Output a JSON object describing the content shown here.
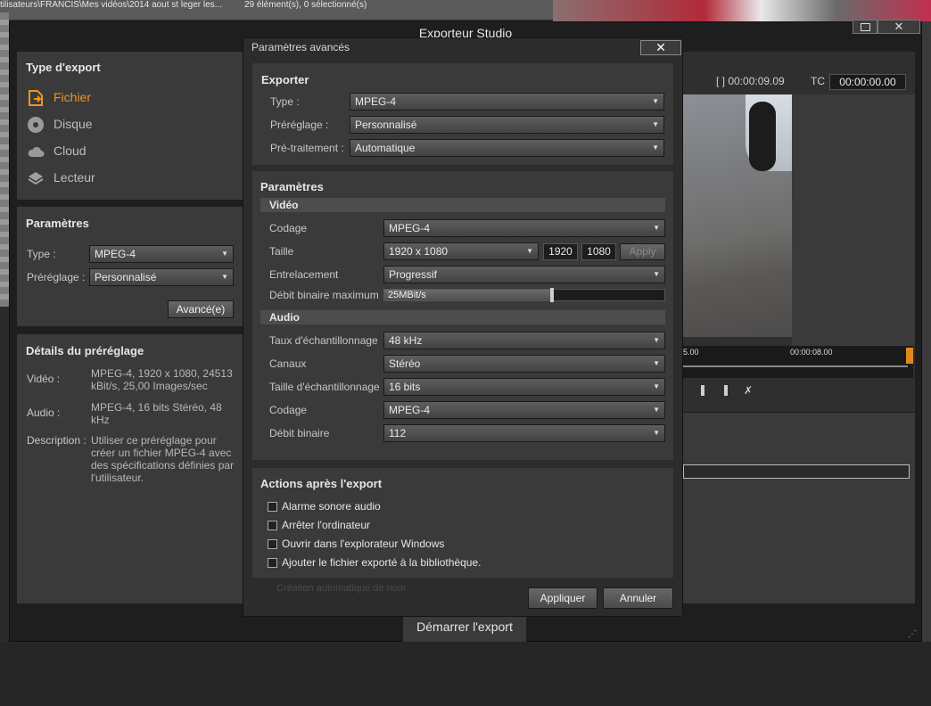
{
  "background": {
    "explorer_path": "tilisateurs\\FRANCIS\\Mes vidéos\\2014 aout st leger les...",
    "explorer_count": "29 élément(s), 0 sélectionné(s)",
    "ghost_caption": "Création automatique de nom"
  },
  "window": {
    "title": "Exporteur Studio",
    "maximize_icon": "maximize-icon",
    "close_label": "✕"
  },
  "export_type": {
    "title": "Type d'export",
    "items": [
      {
        "label": "Fichier",
        "icon": "file-export-icon",
        "active": true
      },
      {
        "label": "Disque",
        "icon": "disc-icon",
        "active": false
      },
      {
        "label": "Cloud",
        "icon": "cloud-icon",
        "active": false
      },
      {
        "label": "Lecteur",
        "icon": "device-icon",
        "active": false
      }
    ]
  },
  "params": {
    "title": "Paramètres",
    "type_label": "Type :",
    "type_value": "MPEG-4",
    "preset_label": "Préréglage :",
    "preset_value": "Personnalisé",
    "advanced_button": "Avancé(e)"
  },
  "preset_details": {
    "title": "Détails du préréglage",
    "video_label": "Vidéo :",
    "video_value": "MPEG-4, 1920 x 1080, 24513 kBit/s, 25,00 Images/sec",
    "audio_label": "Audio :",
    "audio_value": "MPEG-4, 16 bits Stéréo, 48 kHz",
    "description_label": "Description :",
    "description_value": "Utiliser ce préréglage pour créer un fichier MPEG-4 avec des spécifications définies par l'utilisateur."
  },
  "preview": {
    "duration": "[ ] 00:00:09.09",
    "tc_label": "TC",
    "tc_value": "00:00:00.00",
    "tick_left": "5.00",
    "tick_right": "00:00:08.00",
    "accent": "#e08a1c"
  },
  "start_button": "Démarrer l'export",
  "advanced": {
    "title": "Paramètres avancés",
    "close_label": "✕",
    "exporter": {
      "title": "Exporter",
      "type_label": "Type :",
      "type_value": "MPEG-4",
      "preset_label": "Préréglage :",
      "preset_value": "Personnalisé",
      "pre_label": "Pré-traitement :",
      "pre_value": "Automatique"
    },
    "settings": {
      "title": "Paramètres",
      "video_header": "Vidéo",
      "codec_label": "Codage",
      "codec_value": "MPEG-4",
      "size_label": "Taille",
      "size_value": "1920 x 1080",
      "width": "1920",
      "height": "1080",
      "apply_small": "Apply",
      "interlace_label": "Entrelacement",
      "interlace_value": "Progressif",
      "bitrate_max_label": "Débit binaire maximum",
      "bitrate_max_value": "25MBit/s",
      "bitrate_max_fraction": 0.6,
      "audio_header": "Audio",
      "samplerate_label": "Taux d'échantillonnage",
      "samplerate_value": "48 kHz",
      "channels_label": "Canaux",
      "channels_value": "Stéréo",
      "samplesize_label": "Taille d'échantillonnage",
      "samplesize_value": "16 bits",
      "acodec_label": "Codage",
      "acodec_value": "MPEG-4",
      "abitrate_label": "Débit binaire",
      "abitrate_value": "112"
    },
    "actions": {
      "title": "Actions après l'export",
      "items": [
        {
          "label": "Alarme sonore audio",
          "checked": false
        },
        {
          "label": "Arrêter l'ordinateur",
          "checked": false
        },
        {
          "label": "Ouvrir dans l'explorateur Windows",
          "checked": false
        },
        {
          "label": "Ajouter le fichier exporté à la bibliothèque.",
          "checked": false
        }
      ]
    },
    "apply_button": "Appliquer",
    "cancel_button": "Annuler"
  }
}
